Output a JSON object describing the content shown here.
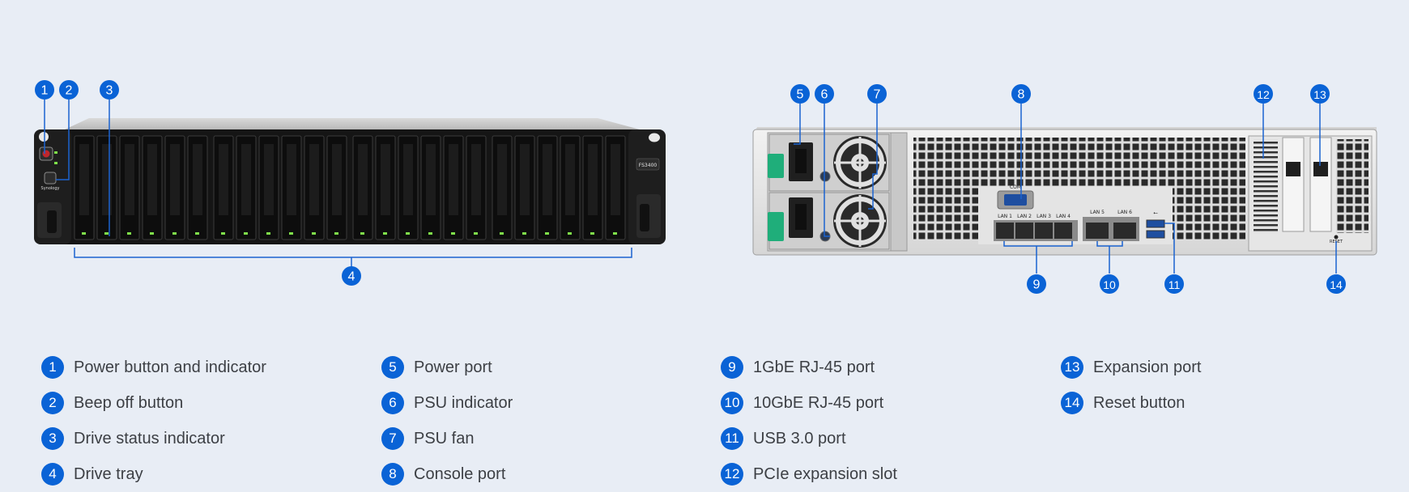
{
  "front_panel": {
    "model_badge": "FS3400",
    "brand": "Synology",
    "callouts": [
      "1",
      "2",
      "3",
      "4"
    ],
    "drive_bays": 24
  },
  "rear_panel": {
    "callouts": [
      "5",
      "6",
      "7",
      "8",
      "9",
      "10",
      "11",
      "12",
      "13",
      "14"
    ],
    "port_labels": {
      "com": "COM",
      "lan": [
        "LAN 1",
        "LAN 2",
        "LAN 3",
        "LAN 4"
      ],
      "lan_10g": [
        "LAN 5",
        "LAN 6"
      ],
      "reset": "RESET"
    }
  },
  "legend": [
    {
      "num": "1",
      "label": "Power button and indicator"
    },
    {
      "num": "2",
      "label": "Beep off button"
    },
    {
      "num": "3",
      "label": "Drive status indicator"
    },
    {
      "num": "4",
      "label": "Drive tray"
    },
    {
      "num": "5",
      "label": "Power port"
    },
    {
      "num": "6",
      "label": "PSU indicator"
    },
    {
      "num": "7",
      "label": "PSU fan"
    },
    {
      "num": "8",
      "label": "Console port"
    },
    {
      "num": "9",
      "label": "1GbE RJ-45 port"
    },
    {
      "num": "10",
      "label": "10GbE RJ-45 port"
    },
    {
      "num": "11",
      "label": "USB 3.0 port"
    },
    {
      "num": "12",
      "label": "PCIe expansion slot"
    },
    {
      "num": "13",
      "label": "Expansion port"
    },
    {
      "num": "14",
      "label": "Reset button"
    }
  ],
  "colors": {
    "accent": "#0a63d6",
    "background": "#e8edf5",
    "led": "#7fe04a",
    "psu_handle": "#1fae7a"
  }
}
